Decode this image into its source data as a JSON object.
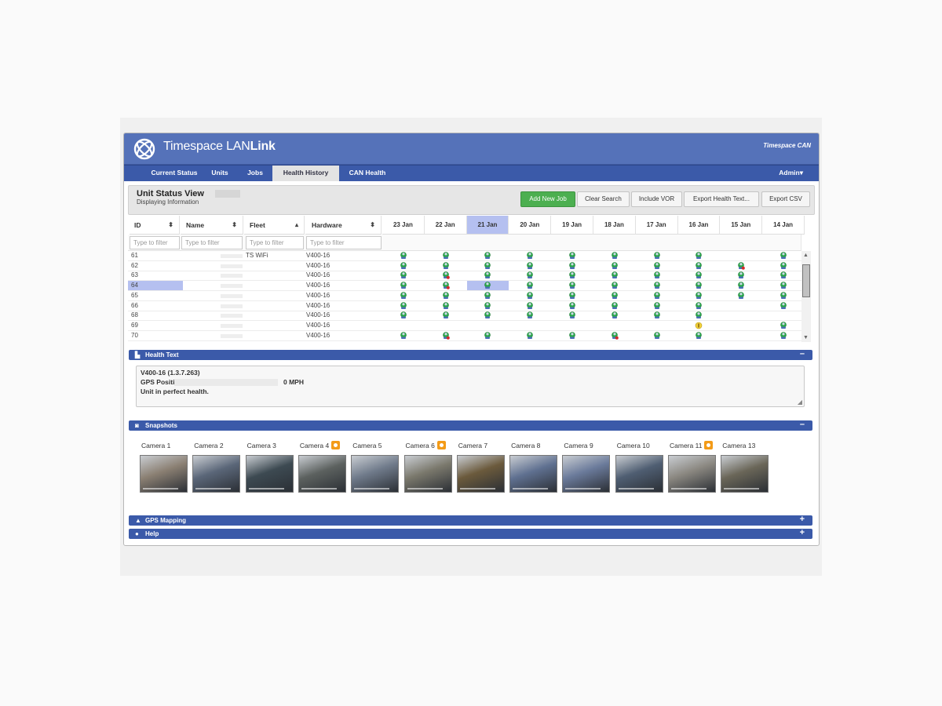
{
  "app": {
    "brand_plain": "Timespace LAN",
    "brand_bold": "Link",
    "corner_label": "Timespace CAN"
  },
  "nav": {
    "items": [
      {
        "label": "Current Status"
      },
      {
        "label": "Units"
      },
      {
        "label": "Jobs"
      },
      {
        "label": "Health History",
        "active": true
      },
      {
        "label": "CAN Health"
      }
    ],
    "admin": "Admin"
  },
  "view": {
    "title": "Unit Status View",
    "subtitle": "Displaying Information"
  },
  "actions": {
    "add_new_job": "Add New Job",
    "clear_search": "Clear Search",
    "include_vor": "Include VOR",
    "export_health": "Export Health Text...",
    "export_csv": "Export CSV"
  },
  "table": {
    "columns": {
      "id": "ID",
      "name": "Name",
      "fleet": "Fleet",
      "hardware": "Hardware"
    },
    "filter_placeholder": "Type to filter",
    "dates": [
      "23 Jan",
      "22 Jan",
      "21 Jan",
      "20 Jan",
      "19 Jan",
      "18 Jan",
      "17 Jan",
      "16 Jan",
      "15 Jan",
      "14 Jan"
    ],
    "selected_date": "21 Jan",
    "rows": [
      {
        "id": "61",
        "fleet": "TS WiFi",
        "hardware": "V400-16",
        "status": [
          "ok",
          "ok",
          "ok",
          "ok",
          "ok",
          "ok",
          "ok",
          "ok",
          "",
          "ok"
        ]
      },
      {
        "id": "62",
        "fleet": "",
        "hardware": "V400-16",
        "status": [
          "ok",
          "ok",
          "ok",
          "ok",
          "ok",
          "ok",
          "ok",
          "ok",
          "warn",
          "ok"
        ]
      },
      {
        "id": "63",
        "fleet": "",
        "hardware": "V400-16",
        "status": [
          "ok",
          "warn",
          "ok",
          "ok",
          "ok",
          "ok",
          "ok",
          "ok",
          "ok",
          "ok"
        ]
      },
      {
        "id": "64",
        "fleet": "",
        "hardware": "V400-16",
        "selected": true,
        "status": [
          "ok",
          "warn",
          "ok",
          "ok",
          "ok",
          "ok",
          "ok",
          "ok",
          "ok",
          "ok"
        ]
      },
      {
        "id": "65",
        "fleet": "",
        "hardware": "V400-16",
        "status": [
          "ok",
          "ok",
          "ok",
          "ok",
          "ok",
          "ok",
          "ok",
          "ok",
          "ok",
          "ok"
        ]
      },
      {
        "id": "66",
        "fleet": "",
        "hardware": "V400-16",
        "status": [
          "ok",
          "ok",
          "ok",
          "ok",
          "ok",
          "ok",
          "ok",
          "ok",
          "",
          "ok"
        ]
      },
      {
        "id": "68",
        "fleet": "",
        "hardware": "V400-16",
        "status": [
          "ok",
          "ok",
          "ok",
          "ok",
          "ok",
          "ok",
          "ok",
          "ok",
          "",
          ""
        ]
      },
      {
        "id": "69",
        "fleet": "",
        "hardware": "V400-16",
        "status": [
          "",
          "",
          "",
          "",
          "",
          "",
          "",
          "key",
          "",
          "ok"
        ]
      },
      {
        "id": "70",
        "fleet": "",
        "hardware": "V400-16",
        "status": [
          "ok",
          "warn",
          "ok",
          "ok",
          "ok",
          "warn",
          "ok",
          "ok",
          "",
          "ok"
        ]
      }
    ]
  },
  "health_text": {
    "title": "Health Text",
    "line1": "V400-16 (1.3.7.263)",
    "gps_label": "GPS Position:",
    "speed": "0 MPH",
    "line3": "Unit in perfect health."
  },
  "snapshots": {
    "title": "Snapshots",
    "cameras": [
      {
        "label": "Camera 1",
        "badge": false,
        "tone": "#8a7f72"
      },
      {
        "label": "Camera 2",
        "badge": false,
        "tone": "#5a6678"
      },
      {
        "label": "Camera 3",
        "badge": false,
        "tone": "#3d4a52"
      },
      {
        "label": "Camera 4",
        "badge": true,
        "tone": "#5c615f"
      },
      {
        "label": "Camera 5",
        "badge": false,
        "tone": "#6f7a8a"
      },
      {
        "label": "Camera 6",
        "badge": true,
        "tone": "#7a786c"
      },
      {
        "label": "Camera 7",
        "badge": false,
        "tone": "#6b5a3c"
      },
      {
        "label": "Camera 8",
        "badge": false,
        "tone": "#5f7090"
      },
      {
        "label": "Camera 9",
        "badge": false,
        "tone": "#6a7a9a"
      },
      {
        "label": "Camera 10",
        "badge": false,
        "tone": "#4f5e72"
      },
      {
        "label": "Camera 11",
        "badge": true,
        "tone": "#8a8780"
      },
      {
        "label": "Camera 13",
        "badge": false,
        "tone": "#6a6658"
      }
    ]
  },
  "gps_mapping": {
    "title": "GPS Mapping"
  },
  "help": {
    "title": "Help"
  },
  "colors": {
    "nav_blue": "#3b5aa9",
    "header_blue": "#5572b9",
    "accent_green": "#4caf50",
    "badge_orange": "#f39b18"
  }
}
